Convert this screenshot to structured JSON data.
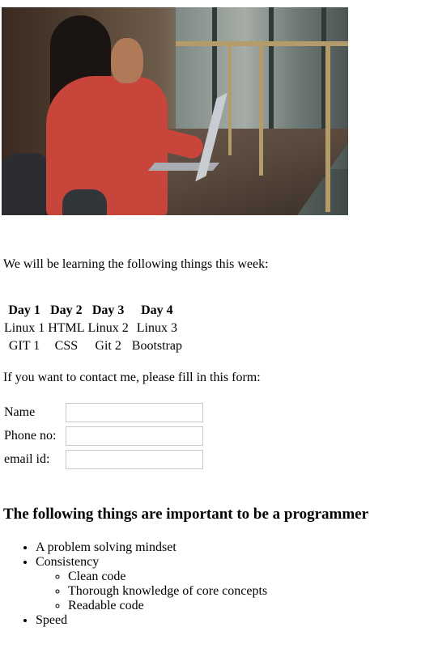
{
  "hero_image": {
    "description_icon": "woman-laptop-photo"
  },
  "intro_text": "We will be learning the following things this week:",
  "schedule": {
    "headers": [
      "Day 1",
      "Day 2",
      "Day 3",
      "Day 4"
    ],
    "rows": [
      [
        "Linux 1",
        "HTML",
        "Linux 2",
        "Linux 3"
      ],
      [
        "GIT 1",
        "CSS",
        "Git 2",
        "Bootstrap"
      ]
    ]
  },
  "contact_prompt": "If you want to contact me, please fill in this form:",
  "form": {
    "name_label": "Name",
    "name_value": "",
    "phone_label": "Phone no:",
    "phone_value": "",
    "email_label": "email id:",
    "email_value": ""
  },
  "important_heading": "The following things are important to be a programmer",
  "important_list": {
    "item1": "A problem solving mindset",
    "item2": "Consistency",
    "sub1": "Clean code",
    "sub2": "Thorough knowledge of core concepts",
    "sub3": "Readable code",
    "item3": "Speed"
  }
}
